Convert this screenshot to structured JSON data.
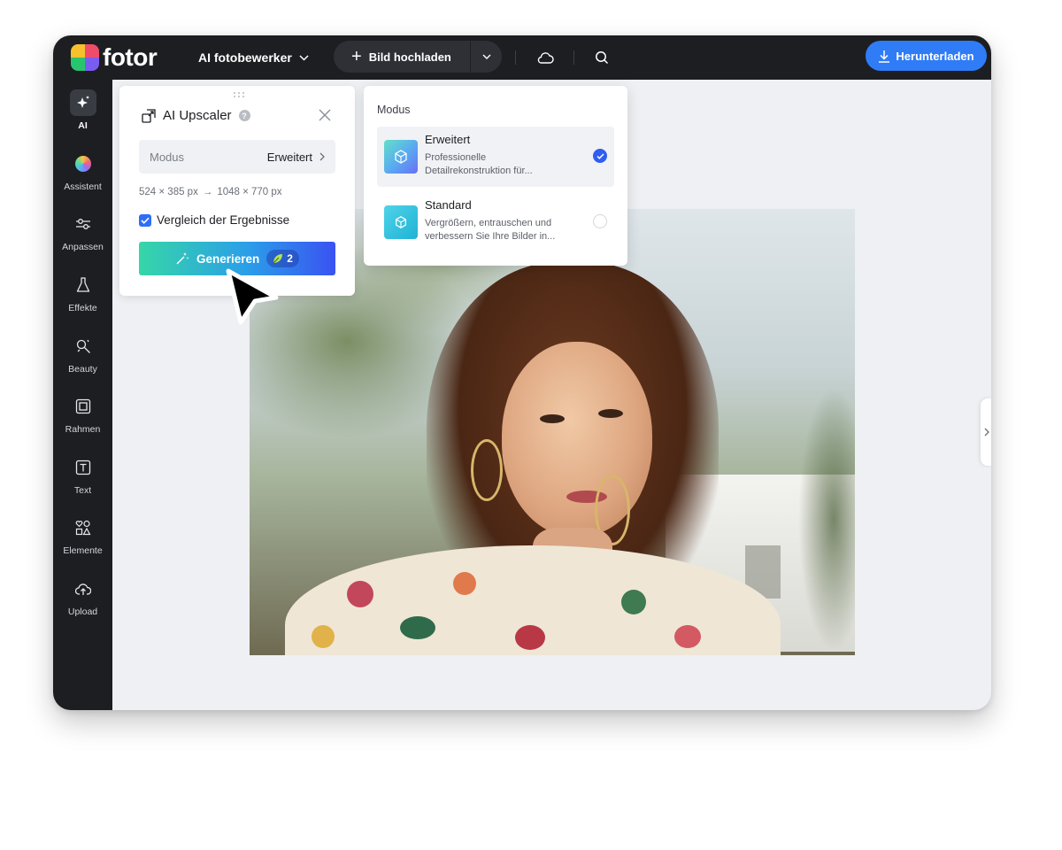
{
  "app": {
    "logo_text": "fotor",
    "menu_title": "AI fotobewerker",
    "upload_label": "Bild hochladen",
    "download_label": "Herunterladen",
    "colors": {
      "accent": "#2f7cf6",
      "topbar": "#1d1e22",
      "canvas": "#eef0f3"
    }
  },
  "icons": {
    "menu_chevron": "chevron-down-icon",
    "upload": "plus-icon",
    "upload_more": "chevron-down-icon",
    "cloud": "cloud-icon",
    "search": "search-icon",
    "download": "download-icon"
  },
  "sidebar": {
    "items": [
      {
        "label": "AI",
        "icon": "sparkle-icon",
        "active": true
      },
      {
        "label": "Assistent",
        "icon": "assistant-orb-icon",
        "active": false
      },
      {
        "label": "Anpassen",
        "icon": "sliders-icon",
        "active": false
      },
      {
        "label": "Effekte",
        "icon": "flask-icon",
        "active": false
      },
      {
        "label": "Beauty",
        "icon": "beauty-wand-icon",
        "active": false
      },
      {
        "label": "Rahmen",
        "icon": "frame-icon",
        "active": false
      },
      {
        "label": "Text",
        "icon": "text-box-icon",
        "active": false
      },
      {
        "label": "Elemente",
        "icon": "shapes-icon",
        "active": false
      },
      {
        "label": "Upload",
        "icon": "cloud-upload-icon",
        "active": false
      }
    ]
  },
  "panel": {
    "title": "AI Upscaler",
    "help": "?",
    "modus_label": "Modus",
    "modus_value": "Erweitert",
    "source_size": "524 × 385 px",
    "arrow": "→",
    "target_size": "1048 × 770 px",
    "compare_label": "Vergleich der Ergebnisse",
    "compare_checked": true,
    "generate_label": "Generieren",
    "credits": "2"
  },
  "dropdown": {
    "title": "Modus",
    "options": [
      {
        "name": "Erweitert",
        "desc_line1": "Professionelle",
        "desc_line2": "Detailrekonstruktion für...",
        "selected": true
      },
      {
        "name": "Standard",
        "desc_line1": "Vergrößern, entrauschen und",
        "desc_line2": "verbessern Sie Ihre Bilder in...",
        "selected": false
      }
    ]
  }
}
